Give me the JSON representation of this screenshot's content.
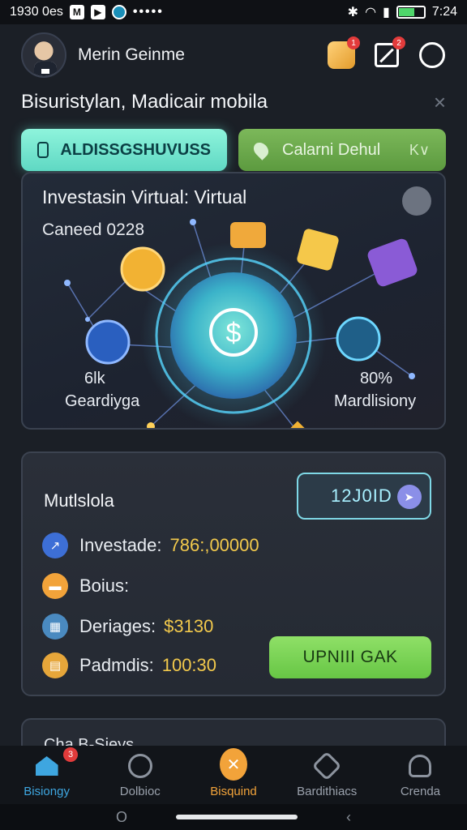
{
  "status_bar": {
    "time_left": "1930 0es",
    "time_right": "7:24"
  },
  "header": {
    "user_name": "Merin Geinme",
    "notif_badge": "1",
    "edit_badge": "2"
  },
  "subtitle": {
    "text": "Bisuristylan, Madicair mobila",
    "close": "×"
  },
  "pills": {
    "left_label": "ALDISSGSHUVUSS",
    "right_label": "Calarni Dehul",
    "right_chevron": "K∨"
  },
  "hero": {
    "title": "Investasin Virtual: Virtual",
    "subtitle": "Caneed 0228",
    "left_pct": "6lk",
    "left_label": "Geardiyga",
    "right_pct": "80%",
    "right_label": "Mardlisiony"
  },
  "panel": {
    "title": "Mutlslola",
    "code": "12J0ID",
    "rows": [
      {
        "label": "Investade:",
        "value": "786:,00000"
      },
      {
        "label": "Boius:",
        "value": ""
      },
      {
        "label": "Deriages:",
        "value": "$3130"
      },
      {
        "label": "Padmdis:",
        "value": "100:30"
      }
    ],
    "cta": "UPNIII GAK"
  },
  "peek": {
    "title": "Cha B-Sieys"
  },
  "bottom_nav": {
    "badge": "3",
    "items": [
      {
        "label": "Bisiongy",
        "icon": "home-icon"
      },
      {
        "label": "Dolbioc",
        "icon": "refresh-icon"
      },
      {
        "label": "Bisquind",
        "icon": "star-icon"
      },
      {
        "label": "Bardithiacs",
        "icon": "gamepad-icon"
      },
      {
        "label": "Crenda",
        "icon": "profile-icon"
      }
    ]
  },
  "colors": {
    "accent_teal": "#5fd8c3",
    "accent_green": "#67c645",
    "accent_orange": "#f2a33a",
    "gold_text": "#f2c94c",
    "nav_active": "#3ea6e0"
  }
}
